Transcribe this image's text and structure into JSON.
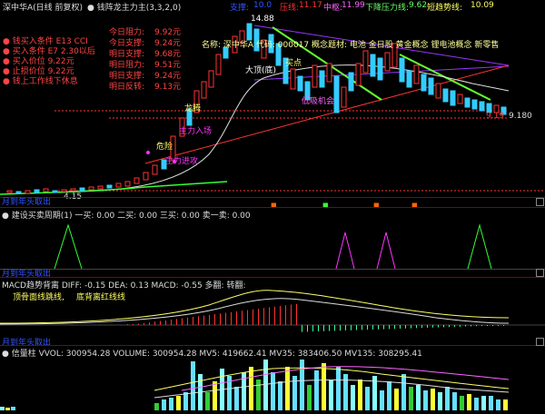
{
  "header": {
    "stock": "深中华A(日线 前复权)",
    "indicator": "● 钱阵龙主力主(3,3,2,0)",
    "support_label": "支撑:",
    "support_val": "10.0",
    "pressure_label": "压线:",
    "pressure_val": "11.17",
    "mid_label": "中枢:",
    "mid_val": "11.99",
    "down_label": "下降压力线:",
    "down_val": "9.62",
    "trend_label": "短趋势线:",
    "trend_val": "10.09"
  },
  "left_panel": [
    {
      "text": "● 钱买入条件 E13 CCI",
      "color": "#ff4444"
    },
    {
      "text": "● 买入条件 E7 2.30以后",
      "color": "#ff4444"
    },
    {
      "text": "● 买入价位 9.22元",
      "color": "#ff4444"
    },
    {
      "text": "● 止损价位 9.22元",
      "color": "#ff4444"
    },
    {
      "text": "● 钱上工作线下休息",
      "color": "#ff4444"
    }
  ],
  "right_panel": [
    {
      "label": "今日阻力:",
      "value": "9.92元"
    },
    {
      "label": "今日支撑:",
      "value": "9.24元"
    },
    {
      "label": "明日支撑:",
      "value": "9.68元"
    },
    {
      "label": "明日阻力:",
      "value": "9.51元"
    },
    {
      "label": "明日支撑:",
      "value": "9.24元"
    },
    {
      "label": "明日反转:",
      "value": "9.13元"
    }
  ],
  "chart_labels": {
    "concepts": "名称: 深中华A 代码: 000017 概念题材: 电池 金日股 黄金概念 锂电池概念 新零售",
    "peak": "14.88",
    "buy_point": "买点",
    "big_top": "大顶(底)",
    "dragon": "龙腾",
    "main_force": "主力入场",
    "danger": "危险",
    "main_push": "主力进攻",
    "low_absorb": "低吸机会",
    "price_now": "9.19",
    "price_r": "9.180",
    "left_low": "4.15"
  },
  "sub1_title": "月到年头取出",
  "sub2": {
    "title": "● 建设买卖周期(1) 一买: 0.00 二买: 0.00 三买: 0.00 卖一卖: 0.00",
    "bar_label": "月到年头取出"
  },
  "sub3": {
    "title": "MACD趋势背离 DIFF: -0.15 DEA: 0.13 MACD: -0.55 多翻: 转翻:",
    "note1": "顶骨面线跳线,",
    "note2": "底背离红线线",
    "bar_label": "月到年头取出"
  },
  "sub4": {
    "title": "● 信量柱 VVOL: 300954.28 VOLUME: 300954.28 MV5: 419662.41 MV35: 383406.50 MV135: 308295.41"
  }
}
